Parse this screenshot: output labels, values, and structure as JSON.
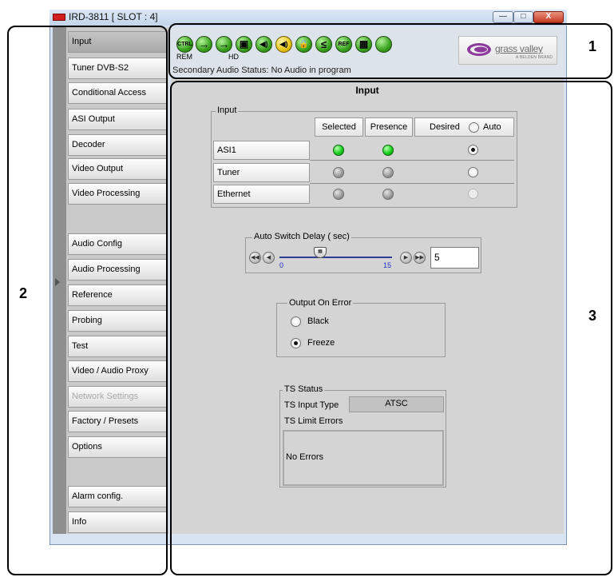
{
  "window": {
    "title": "IRD-3811 [ SLOT : 4]",
    "min_glyph": "—",
    "max_glyph": "□",
    "close_glyph": "X"
  },
  "sidebar": {
    "items": [
      {
        "label": "Input",
        "state": "active"
      },
      {
        "label": "Tuner DVB-S2",
        "state": "normal"
      },
      {
        "label": "Conditional Access",
        "state": "normal"
      },
      {
        "label": "ASI Output",
        "state": "normal"
      },
      {
        "label": "Decoder",
        "state": "normal"
      },
      {
        "label": "Video Output",
        "state": "normal"
      },
      {
        "label": "Video Processing",
        "state": "normal"
      },
      {
        "label": "Audio Config",
        "state": "normal"
      },
      {
        "label": "Audio Processing",
        "state": "normal"
      },
      {
        "label": "Reference",
        "state": "normal"
      },
      {
        "label": "Probing",
        "state": "normal"
      },
      {
        "label": "Test",
        "state": "normal"
      },
      {
        "label": "Video / Audio Proxy",
        "state": "normal"
      },
      {
        "label": "Network Settings",
        "state": "disabled"
      },
      {
        "label": "Factory / Presets",
        "state": "normal"
      },
      {
        "label": "Options",
        "state": "normal"
      },
      {
        "label": "Alarm config.",
        "state": "normal"
      },
      {
        "label": "Info",
        "state": "normal"
      }
    ]
  },
  "status_bar": {
    "icons": [
      {
        "name": "ctrl-icon",
        "label": "CTRL",
        "caption": "REM",
        "color": "green"
      },
      {
        "name": "arrow-right-icon",
        "label": "→",
        "caption": "",
        "color": "green"
      },
      {
        "name": "arrow-right-hd-icon",
        "label": "→",
        "caption": "HD",
        "color": "green"
      },
      {
        "name": "card-icon",
        "label": "▣",
        "caption": "",
        "color": "green"
      },
      {
        "name": "speaker-icon",
        "label": "◀)",
        "caption": "",
        "color": "green"
      },
      {
        "name": "speaker-secondary-icon",
        "label": "◀)",
        "caption": "",
        "color": "yellow"
      },
      {
        "name": "lock-icon",
        "label": "🔒",
        "caption": "",
        "color": "green"
      },
      {
        "name": "less-than-icon",
        "label": "≤",
        "caption": "",
        "color": "green"
      },
      {
        "name": "ref-icon",
        "label": "REF",
        "caption": "",
        "color": "green"
      },
      {
        "name": "monitor-icon",
        "label": "▦",
        "caption": "",
        "color": "green"
      },
      {
        "name": "status-led-icon",
        "label": "",
        "caption": "",
        "color": "green"
      }
    ],
    "message": "Secondary Audio Status: No Audio in program",
    "logo": {
      "text": "grass valley",
      "subtext": "A BELDEN BRAND"
    }
  },
  "content": {
    "title": "Input",
    "input_group": {
      "legend": "Input",
      "headers": {
        "selected": "Selected",
        "presence": "Presence",
        "desired": "Desired",
        "auto": "Auto"
      },
      "rows": [
        {
          "label": "ASI1",
          "selected": "on",
          "presence": "on",
          "desired": "checked"
        },
        {
          "label": "Tuner",
          "selected": "off",
          "presence": "off",
          "desired": "unchecked"
        },
        {
          "label": "Ethernet",
          "selected": "off",
          "presence": "off",
          "desired": "disabled"
        }
      ]
    },
    "auto_switch": {
      "legend": "Auto Switch Delay ( sec)",
      "min": "0",
      "max": "15",
      "value": "5"
    },
    "output_on_error": {
      "legend": "Output On Error",
      "options": [
        {
          "label": "Black",
          "checked": false
        },
        {
          "label": "Freeze",
          "checked": true
        }
      ]
    },
    "ts_status": {
      "legend": "TS Status",
      "input_type_label": "TS Input Type",
      "input_type_value": "ATSC",
      "limit_errors_label": "TS Limit Errors",
      "limit_errors_value": "No Errors"
    }
  },
  "callouts": [
    {
      "number": "1"
    },
    {
      "number": "2"
    },
    {
      "number": "3"
    }
  ]
}
